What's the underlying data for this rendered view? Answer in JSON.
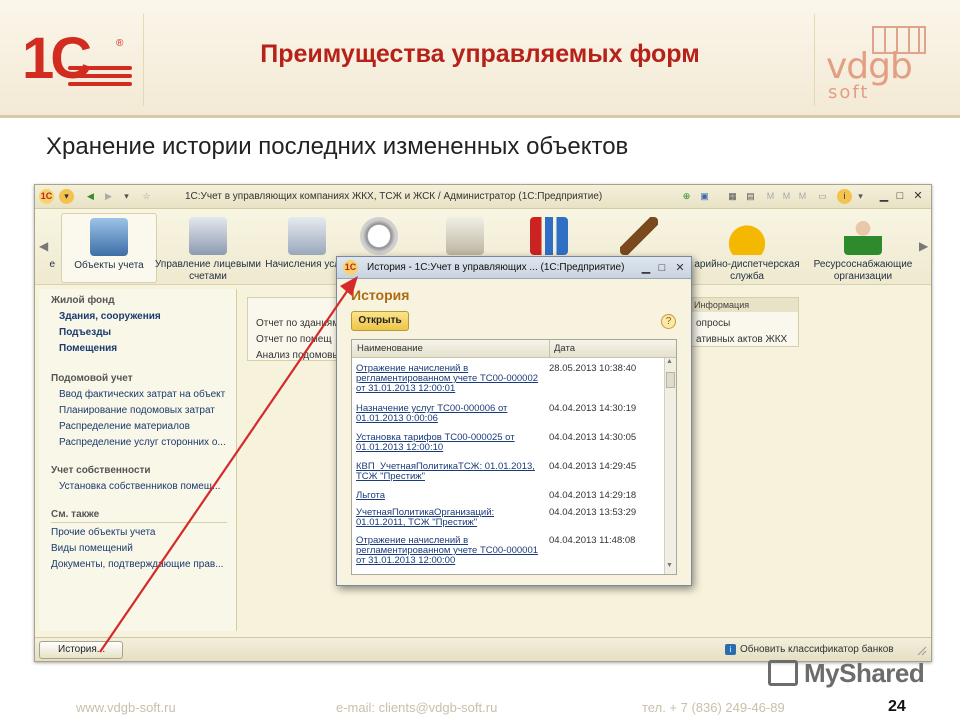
{
  "slide": {
    "title": "Преимущества управляемых форм",
    "subtitle": "Хранение истории последних измененных объектов",
    "logo_left": "1С",
    "logo_right": "vdgb",
    "logo_right_sub": "soft",
    "page_number": "24",
    "footer_site": "www.vdgb-soft.ru",
    "footer_email": "e-mail: clients@vdgb-soft.ru",
    "footer_phone": "тел. + 7 (836) 249-46-89",
    "watermark": "MyShared"
  },
  "app": {
    "window_title": "1С:Учет в управляющих компаниях ЖКХ, ТСЖ и ЖСК / Администратор  (1С:Предприятие)",
    "sections": [
      {
        "label": "е",
        "icon": "partial-icon"
      },
      {
        "label": "Объекты учета",
        "icon": "buildings-icon"
      },
      {
        "label": "Управление лицевыми счетами",
        "icon": "printer-icon"
      },
      {
        "label": "Начисления услуг",
        "icon": "calculator-icon"
      },
      {
        "label": "",
        "icon": "meter-icon"
      },
      {
        "label": "",
        "icon": "document-icon"
      },
      {
        "label": "",
        "icon": "bar-chart-icon"
      },
      {
        "label": "",
        "icon": "gavel-icon"
      },
      {
        "label": "арийно-диспетчерская служба",
        "icon": "helmet-icon"
      },
      {
        "label": "Ресурсоснабжающие организации",
        "icon": "person-icon"
      }
    ],
    "nav": {
      "group1": "Жилой фонд",
      "group1_items": [
        "Здания, сооружения",
        "Подъезды",
        "Помещения"
      ],
      "group2": "Подомовой учет",
      "group2_items": [
        "Ввод фактических затрат на объект",
        "Планирование подомовых затрат",
        "Распределение материалов",
        "Распределение услуг сторонних о..."
      ],
      "group3": "Учет собственности",
      "group3_items": [
        "Установка собственников помещ..."
      ],
      "group4": "См. также",
      "group4_items": [
        "Прочие объекты учета",
        "Виды помещений",
        "Документы, подтверждающие прав..."
      ]
    },
    "work": {
      "reports": [
        "Отчет по зданиям",
        "Отчет по помещ",
        "Анализ подомовых"
      ],
      "info_header": "Информация",
      "info_items": [
        "опросы",
        "ативных актов ЖКХ"
      ]
    },
    "status": {
      "history_button": "История...",
      "info_text": "Обновить классификатор банков"
    }
  },
  "dialog": {
    "title": "История - 1С:Учет в управляющих ...  (1С:Предприятие)",
    "heading": "История",
    "open_button": "Открыть",
    "help": "?",
    "col_name": "Наименование",
    "col_date": "Дата",
    "rows": [
      {
        "name": "Отражение начислений в регламентированном учете ТС00-000002 от 31.01.2013 12:00:01",
        "date": "28.05.2013 10:38:40"
      },
      {
        "name": "Назначение услуг ТС00-000006 от 01.01.2013 0:00:06",
        "date": "04.04.2013 14:30:19"
      },
      {
        "name": "Установка тарифов ТС00-000025 от 01.01.2013 12:00:10",
        "date": "04.04.2013 14:30:05"
      },
      {
        "name": "КВП_УчетнаяПолитикаТСЖ: 01.01.2013, ТСЖ \"Престиж\"",
        "date": "04.04.2013 14:29:45"
      },
      {
        "name": "Льгота",
        "date": "04.04.2013 14:29:18"
      },
      {
        "name": "УчетнаяПолитикаОрганизаций: 01.01.2011, ТСЖ \"Престиж\"",
        "date": "04.04.2013 13:53:29"
      },
      {
        "name": "Отражение начислений в регламентированном учете ТС00-000001 от 31.01.2013 12:00:00",
        "date": "04.04.2013 11:48:08"
      }
    ]
  },
  "colors": {
    "title_red": "#b6221a",
    "arrow_red": "#d42a2a",
    "dialog_heading": "#b06a12"
  }
}
